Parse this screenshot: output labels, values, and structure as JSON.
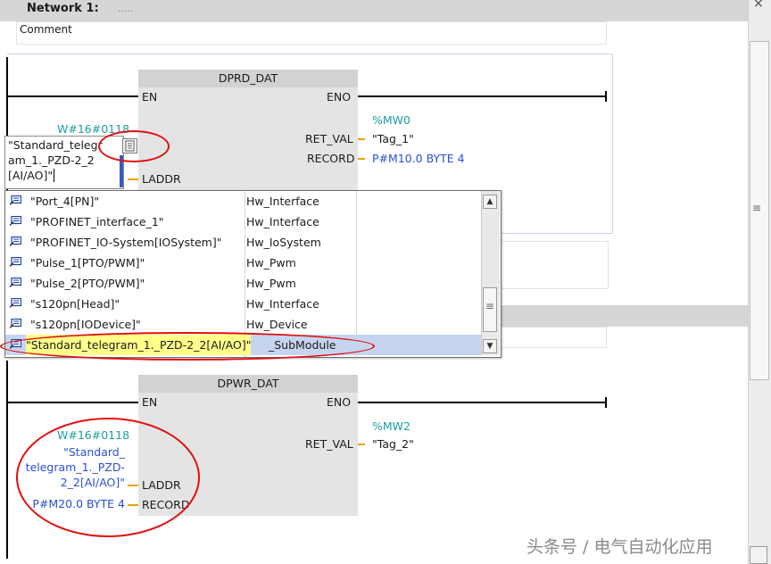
{
  "network": {
    "title": "Network 1:",
    "dots": ".....",
    "comment": "Comment"
  },
  "block1": {
    "name": "DPRD_DAT",
    "pin_en": "EN",
    "pin_eno": "ENO",
    "pin_ret_val": "RET_VAL",
    "pin_record": "RECORD",
    "pin_laddr": "LADDR",
    "const_w": "W#16#0118",
    "input_lines": [
      "\"Standard_telegr",
      "am_1._PZD-2_2",
      "[AI/AO]\""
    ],
    "ret_addr": "%MW0",
    "ret_tag": "\"Tag_1\"",
    "record_value": "P#M10.0 BYTE 4"
  },
  "dropdown": {
    "items": [
      {
        "name": "\"Port_4[PN]\"",
        "type": "Hw_Interface"
      },
      {
        "name": "\"PROFINET_interface_1\"",
        "type": "Hw_Interface"
      },
      {
        "name": "\"PROFINET_IO-System[IOSystem]\"",
        "type": "Hw_IoSystem"
      },
      {
        "name": "\"Pulse_1[PTO/PWM]\"",
        "type": "Hw_Pwm"
      },
      {
        "name": "\"Pulse_2[PTO/PWM]\"",
        "type": "Hw_Pwm"
      },
      {
        "name": "\"s120pn[Head]\"",
        "type": "Hw_Interface"
      },
      {
        "name": "\"s120pn[IODevice]\"",
        "type": "Hw_Device"
      },
      {
        "name": "\"Standard_telegram_1._PZD-2_2[AI/AO]\"",
        "type": "_SubModule"
      }
    ],
    "selected_index": 7,
    "scroll_up": "▲",
    "scroll_down": "▼",
    "thumb_grip": "≡"
  },
  "block2": {
    "name": "DPWR_DAT",
    "pin_en": "EN",
    "pin_eno": "ENO",
    "pin_ret_val": "RET_VAL",
    "pin_laddr": "LADDR",
    "pin_record": "RECORD",
    "const_w": "W#16#0118",
    "laddr_lines": [
      "\"Standard_",
      "telegram_1._PZD-",
      "2_2[AI/AO]\""
    ],
    "record_value": "P#M20.0 BYTE 4",
    "ret_addr": "%MW2",
    "ret_tag": "\"Tag_2\""
  },
  "right_scrollbar": {
    "grip": "≡",
    "close_glyph": "×"
  },
  "watermark": "头条号 / 电气自动化应用",
  "colors": {
    "highlight_ellipse": "#e01010",
    "blue_text": "#2a4fd4",
    "teal_text": "#1c9d9d",
    "pin_stub": "#e8a400",
    "selection_row": "#c6d5ef"
  }
}
